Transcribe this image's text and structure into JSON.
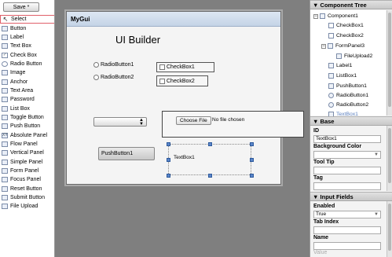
{
  "toolbar": {
    "save_label": "Save *"
  },
  "palette": {
    "items": [
      {
        "label": "Select",
        "icon": "cursor-icon"
      },
      {
        "label": "Button",
        "icon": "button-icon"
      },
      {
        "label": "Label",
        "icon": "label-icon"
      },
      {
        "label": "Text Box",
        "icon": "textbox-icon"
      },
      {
        "label": "Check Box",
        "icon": "checkbox-icon"
      },
      {
        "label": "Radio Button",
        "icon": "radio-icon"
      },
      {
        "label": "Image",
        "icon": "image-icon"
      },
      {
        "label": "Anchor",
        "icon": "anchor-icon"
      },
      {
        "label": "Text Area",
        "icon": "textarea-icon"
      },
      {
        "label": "Password",
        "icon": "password-icon"
      },
      {
        "label": "List Box",
        "icon": "listbox-icon"
      },
      {
        "label": "Toggle Button",
        "icon": "toggle-icon"
      },
      {
        "label": "Push Button",
        "icon": "pushbutton-icon"
      },
      {
        "label": "Absolute Panel",
        "icon": "absolute-panel-icon"
      },
      {
        "label": "Flow Panel",
        "icon": "flow-panel-icon"
      },
      {
        "label": "Vertical Panel",
        "icon": "vertical-panel-icon"
      },
      {
        "label": "Simple Panel",
        "icon": "simple-panel-icon"
      },
      {
        "label": "Form Panel",
        "icon": "form-panel-icon"
      },
      {
        "label": "Focus Panel",
        "icon": "focus-panel-icon"
      },
      {
        "label": "Reset Button",
        "icon": "reset-button-icon"
      },
      {
        "label": "Submit Button",
        "icon": "submit-button-icon"
      },
      {
        "label": "File Upload",
        "icon": "file-upload-icon"
      }
    ]
  },
  "canvas": {
    "window_title": "MyGui",
    "heading": "UI Builder",
    "radio1": "RadioButton1",
    "radio2": "RadioButton2",
    "checkbox1": "CheckBox1",
    "checkbox2": "CheckBox2",
    "listbox_value": "",
    "choose_file": "Choose File",
    "no_file": "No file chosen",
    "push_button": "PushButton1",
    "textbox": "TextBox1"
  },
  "tree": {
    "header": "Component Tree",
    "items": [
      "Component1",
      "CheckBox1",
      "CheckBox2",
      "FormPanel3",
      "FileUpload2",
      "Label1",
      "ListBox1",
      "PushButton1",
      "RadioButton1",
      "RadioButton2",
      "TextBox1"
    ]
  },
  "base": {
    "header": "Base",
    "id_label": "ID",
    "id_value": "TextBox1",
    "bg_label": "Background Color",
    "bg_value": "",
    "tooltip_label": "Tool Tip",
    "tooltip_value": "",
    "tag_label": "Tag",
    "tag_value": ""
  },
  "input_fields": {
    "header": "Input Fields",
    "enabled_label": "Enabled",
    "enabled_value": "True",
    "tabindex_label": "Tab Index",
    "tabindex_value": "",
    "name_label": "Name",
    "name_value": "",
    "value_label": "Value"
  },
  "colors": {
    "selection": "#e0606a",
    "handle": "#5b86c9",
    "active_tree": "#5a7fbf"
  }
}
